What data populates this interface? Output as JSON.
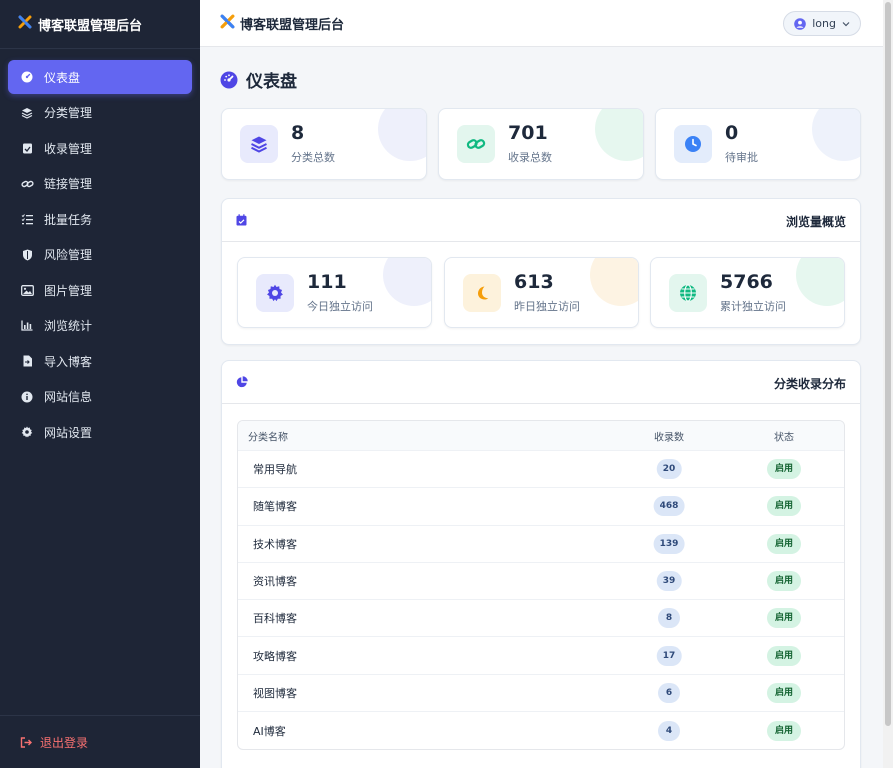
{
  "sidebar": {
    "brand": "博客联盟管理后台",
    "items": [
      {
        "label": "仪表盘",
        "icon": "dashboard-icon",
        "active": true
      },
      {
        "label": "分类管理",
        "icon": "layers-icon"
      },
      {
        "label": "收录管理",
        "icon": "clipboard-check-icon"
      },
      {
        "label": "链接管理",
        "icon": "link-icon"
      },
      {
        "label": "批量任务",
        "icon": "list-check-icon"
      },
      {
        "label": "风险管理",
        "icon": "shield-icon"
      },
      {
        "label": "图片管理",
        "icon": "image-icon"
      },
      {
        "label": "浏览统计",
        "icon": "bar-chart-icon"
      },
      {
        "label": "导入博客",
        "icon": "file-import-icon"
      },
      {
        "label": "网站信息",
        "icon": "info-icon"
      },
      {
        "label": "网站设置",
        "icon": "gear-icon"
      }
    ],
    "logout": "退出登录"
  },
  "topbar": {
    "title": "博客联盟管理后台",
    "user": "long"
  },
  "page": {
    "title": "仪表盘"
  },
  "stats": [
    {
      "value": "8",
      "label": "分类总数",
      "icon": "layers-icon",
      "color": "#4f46e5"
    },
    {
      "value": "701",
      "label": "收录总数",
      "icon": "link-icon",
      "color": "#10b981"
    },
    {
      "value": "0",
      "label": "待审批",
      "icon": "clock-icon",
      "color": "#3b82f6"
    }
  ],
  "traffic": {
    "title": "浏览量概览",
    "items": [
      {
        "value": "111",
        "label": "今日独立访问",
        "icon": "sun-icon",
        "color": "#4f46e5"
      },
      {
        "value": "613",
        "label": "昨日独立访问",
        "icon": "moon-icon",
        "color": "#f59e0b"
      },
      {
        "value": "5766",
        "label": "累计独立访问",
        "icon": "globe-icon",
        "color": "#10b981"
      }
    ]
  },
  "distribution": {
    "title": "分类收录分布",
    "columns": [
      "分类名称",
      "收录数",
      "状态"
    ],
    "rows": [
      {
        "name": "常用导航",
        "count": "20",
        "status": "启用"
      },
      {
        "name": "随笔博客",
        "count": "468",
        "status": "启用"
      },
      {
        "name": "技术博客",
        "count": "139",
        "status": "启用"
      },
      {
        "name": "资讯博客",
        "count": "39",
        "status": "启用"
      },
      {
        "name": "百科博客",
        "count": "8",
        "status": "启用"
      },
      {
        "name": "攻略博客",
        "count": "17",
        "status": "启用"
      },
      {
        "name": "视图博客",
        "count": "6",
        "status": "启用"
      },
      {
        "name": "AI博客",
        "count": "4",
        "status": "启用"
      }
    ]
  }
}
